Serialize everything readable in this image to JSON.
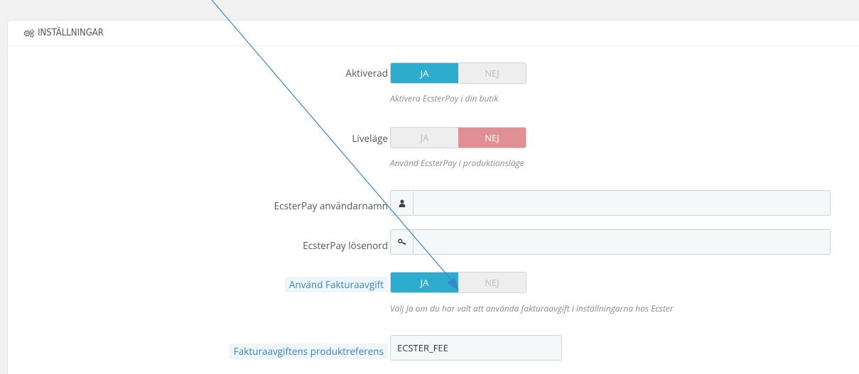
{
  "panel": {
    "title": "INSTÄLLNINGAR",
    "icon": "cogs-icon"
  },
  "settings": {
    "active": {
      "label": "Aktiverad",
      "yes": "JA",
      "no": "NEJ",
      "value": "yes",
      "help": "Aktivera EcsterPay i din butik"
    },
    "live": {
      "label": "Liveläge",
      "yes": "JA",
      "no": "NEJ",
      "value": "no",
      "help": "Använd EcsterPay i produktionsläge"
    },
    "username": {
      "label": "EcsterPay användarnamn",
      "icon": "user-icon",
      "value": ""
    },
    "password": {
      "label": "EcsterPay lösenord",
      "icon": "key-icon",
      "value": ""
    },
    "invoice_fee": {
      "label": "Använd Fakturaavgift",
      "yes": "JA",
      "no": "NEJ",
      "value": "yes",
      "help": "Välj Ja om du har valt att använda fakturaavgift i inställningarna hos Ecster"
    },
    "fee_reference": {
      "label": "Fakturaavgiftens produktreferens",
      "value": "ECSTER_FEE"
    }
  },
  "colors": {
    "switch_yes": "#2eacce",
    "switch_no": "#e08f95",
    "annotation": "#3a86c8"
  }
}
